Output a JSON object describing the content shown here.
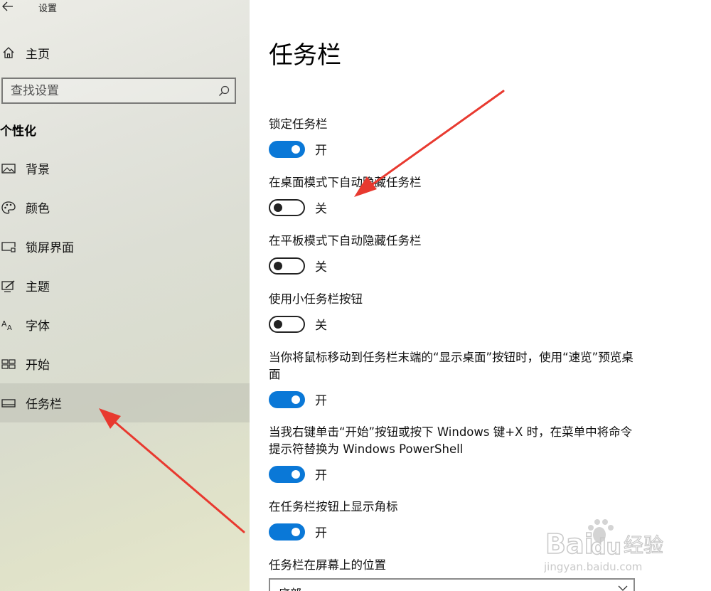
{
  "window": {
    "title": "设置",
    "back_symbol": "←"
  },
  "sidebar": {
    "home_label": "主页",
    "search_placeholder": "查找设置",
    "section_title": "个性化",
    "items": [
      {
        "label": "背景",
        "icon": "picture-icon"
      },
      {
        "label": "颜色",
        "icon": "palette-icon"
      },
      {
        "label": "锁屏界面",
        "icon": "lock-screen-icon"
      },
      {
        "label": "主题",
        "icon": "theme-icon"
      },
      {
        "label": "字体",
        "icon": "font-icon"
      },
      {
        "label": "开始",
        "icon": "start-icon"
      },
      {
        "label": "任务栏",
        "icon": "taskbar-icon",
        "active": true
      }
    ]
  },
  "content": {
    "title": "任务栏",
    "settings": [
      {
        "label": "锁定任务栏",
        "state": "开",
        "on": true
      },
      {
        "label": "在桌面模式下自动隐藏任务栏",
        "state": "关",
        "on": false
      },
      {
        "label": "在平板模式下自动隐藏任务栏",
        "state": "关",
        "on": false
      },
      {
        "label": "使用小任务栏按钮",
        "state": "关",
        "on": false
      },
      {
        "label": "当你将鼠标移动到任务栏末端的“显示桌面”按钮时，使用“速览”预览桌面",
        "state": "开",
        "on": true
      },
      {
        "label": "当我右键单击“开始”按钮或按下 Windows 键+X 时，在菜单中将命令提示符替换为 Windows PowerShell",
        "state": "开",
        "on": true
      },
      {
        "label": "在任务栏按钮上显示角标",
        "state": "开",
        "on": true
      }
    ],
    "position_label": "任务栏在屏幕上的位置",
    "position_value": "底部"
  },
  "watermark": {
    "brand": "Bai",
    "brand2": "du",
    "cn": "经验",
    "url": "jingyan.baidu.com"
  },
  "colors": {
    "accent": "#0a78d7",
    "arrow": "#e8392f"
  }
}
